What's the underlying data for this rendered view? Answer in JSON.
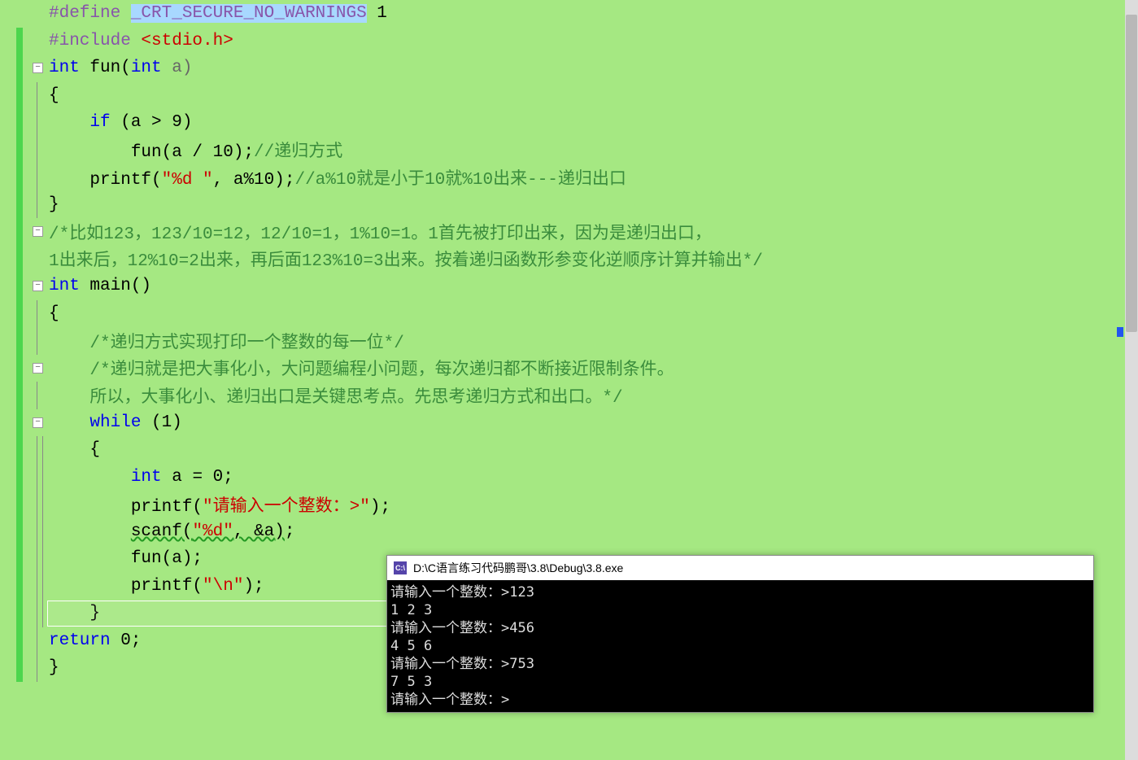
{
  "code": {
    "line1": {
      "macro": "#define ",
      "name": "_CRT_SECURE_NO_WARNINGS",
      "val": " 1"
    },
    "line2": {
      "macro": "#include ",
      "path": "<stdio.h>"
    },
    "line3": {
      "kw1": "int",
      "fn": " fun(",
      "kw2": "int",
      "param": " a)"
    },
    "line4": "{",
    "line5": {
      "pre": "    ",
      "kw": "if",
      "cond": " (a > 9)"
    },
    "line6": {
      "pre": "        fun(a / 10);",
      "comment": "//递归方式"
    },
    "line7": {
      "pre": "    printf(",
      "str": "\"%d \"",
      "mid": ", a%10);",
      "comment": "//a%10就是小于10就%10出来---递归出口"
    },
    "line8": "}",
    "line9": "/*比如123，123/10=12，12/10=1，1%10=1。1首先被打印出来，因为是递归出口，",
    "line10": "1出来后，12%10=2出来，再后面123%10=3出来。按着递归函数形参变化逆顺序计算并输出*/",
    "line11": {
      "kw": "int",
      "fn": " main()"
    },
    "line12": "{",
    "line13": "    /*递归方式实现打印一个整数的每一位*/",
    "line14": "    /*递归就是把大事化小，大问题编程小问题，每次递归都不断接近限制条件。",
    "line15": "    所以，大事化小、递归出口是关键思考点。先思考递归方式和出口。*/",
    "line16": {
      "pre": "    ",
      "kw": "while",
      "cond": " (1)"
    },
    "line17": "    {",
    "line18": {
      "pre": "        ",
      "kw": "int",
      "rest": " a = 0;"
    },
    "line19": {
      "pre": "        printf(",
      "str": "\"请输入一个整数：>\"",
      "post": ");"
    },
    "line20": {
      "pre": "        ",
      "fn": "scanf",
      "op": "(",
      "str": "\"%d\"",
      "mid": ", &a",
      "cp": ")",
      "post": ";"
    },
    "line21": "        fun(a);",
    "line22": {
      "pre": "        printf(",
      "str": "\"\\n\"",
      "post": ");"
    },
    "line23": "    }",
    "line24": {
      "kw": "return",
      "rest": " 0;"
    },
    "line25": "}"
  },
  "console": {
    "title": "D:\\C语言练习代码鹏哥\\3.8\\Debug\\3.8.exe",
    "icon": "C:\\",
    "lines": [
      "请输入一个整数：>123",
      "1 2 3",
      "请输入一个整数：>456",
      "4 5 6",
      "请输入一个整数：>753",
      "7 5 3",
      "请输入一个整数：>"
    ]
  }
}
